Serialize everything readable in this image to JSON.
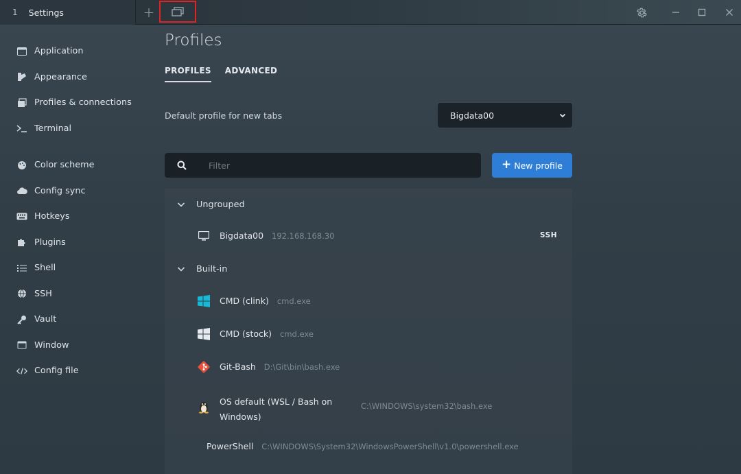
{
  "titlebar": {
    "tab_number": "1",
    "tab_title": "Settings"
  },
  "sidebar": {
    "items": [
      {
        "label": "Application",
        "icon": "application-icon"
      },
      {
        "label": "Appearance",
        "icon": "appearance-icon"
      },
      {
        "label": "Profiles & connections",
        "icon": "profiles-icon"
      },
      {
        "label": "Terminal",
        "icon": "terminal-icon"
      },
      {
        "label": "Color scheme",
        "icon": "palette-icon"
      },
      {
        "label": "Config sync",
        "icon": "cloud-icon"
      },
      {
        "label": "Hotkeys",
        "icon": "keyboard-icon"
      },
      {
        "label": "Plugins",
        "icon": "puzzle-icon"
      },
      {
        "label": "Shell",
        "icon": "list-icon"
      },
      {
        "label": "SSH",
        "icon": "globe-icon"
      },
      {
        "label": "Vault",
        "icon": "key-icon"
      },
      {
        "label": "Window",
        "icon": "window-icon"
      },
      {
        "label": "Config file",
        "icon": "code-icon"
      }
    ]
  },
  "main": {
    "title": "Profiles",
    "tabs": [
      {
        "label": "PROFILES",
        "active": true
      },
      {
        "label": "ADVANCED",
        "active": false
      }
    ],
    "default_profile_label": "Default profile for new tabs",
    "default_profile_value": "Bigdata00",
    "filter_placeholder": "Filter",
    "new_profile_label": "New profile"
  },
  "profiles": {
    "groups": [
      {
        "name": "Ungrouped",
        "items": [
          {
            "name": "Bigdata00",
            "command": "192.168.168.30",
            "tag": "SSH",
            "icon": "monitor-icon"
          }
        ]
      },
      {
        "name": "Built-in",
        "items": [
          {
            "name": "CMD (clink)",
            "command": "cmd.exe",
            "icon": "windows-logo-icon",
            "color": "#19b8d6"
          },
          {
            "name": "CMD (stock)",
            "command": "cmd.exe",
            "icon": "windows-logo-icon",
            "color": "#e6ebef"
          },
          {
            "name": "Git-Bash",
            "command": "D:\\Git\\bin\\bash.exe",
            "icon": "git-icon",
            "color": "#e5533d"
          },
          {
            "name": "OS default (WSL / Bash on Windows)",
            "command": "C:\\WINDOWS\\system32\\bash.exe",
            "icon": "linux-penguin-icon"
          },
          {
            "name": "PowerShell",
            "command": "C:\\WINDOWS\\System32\\WindowsPowerShell\\v1.0\\powershell.exe",
            "icon": ""
          }
        ]
      }
    ]
  }
}
